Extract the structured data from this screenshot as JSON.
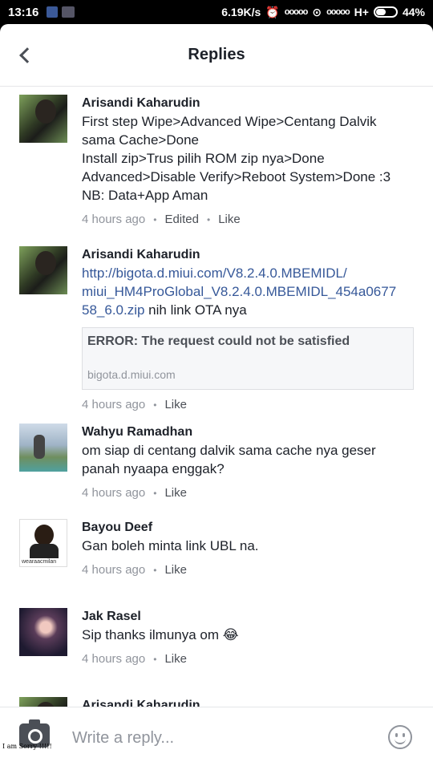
{
  "status_bar": {
    "time": "13:16",
    "speed": "6.19K/s",
    "signal_a": "ooooo",
    "signal_b": "ooooo",
    "network": "H+",
    "battery": "44%"
  },
  "header": {
    "title": "Replies",
    "back_icon": "chevron-left-icon"
  },
  "comments": [
    {
      "author": "Arisandi Kaharudin",
      "lines": [
        "First step Wipe>Advanced Wipe>Centang Dalvik",
        "sama Cache>Done",
        "Install zip>Trus pilih ROM zip nya>Done",
        "Advanced>Disable Verify>Reboot System>Done :3",
        "NB: Data+App Aman"
      ],
      "time": "4 hours ago",
      "edited": "Edited",
      "like": "Like"
    },
    {
      "author": "Arisandi Kaharudin",
      "link_lines": [
        "http://bigota.d.miui.com/V8.2.4.0.MBEMIDL/",
        "miui_HM4ProGlobal_V8.2.4.0.MBEMIDL_454a0677",
        "58_6.0.zip"
      ],
      "suffix": " nih link OTA nya",
      "preview": {
        "title": "ERROR: The request could not be satisfied",
        "domain": "bigota.d.miui.com"
      },
      "time": "4 hours ago",
      "like": "Like"
    },
    {
      "author": "Wahyu Ramadhan",
      "lines": [
        "om siap di centang dalvik sama cache nya geser",
        "panah nyaapa enggak?"
      ],
      "time": "4 hours ago",
      "like": "Like"
    },
    {
      "author": "Bayou Deef",
      "avatar_tag": "wearaacmilan",
      "lines": [
        "Gan boleh minta link UBL na."
      ],
      "time": "4 hours ago",
      "like": "Like"
    },
    {
      "author": "Jak Rasel",
      "lines": [
        "Sip thanks ilmunya om 😂"
      ],
      "time": "4 hours ago",
      "like": "Like"
    },
    {
      "author": "Arisandi Kaharudin"
    }
  ],
  "footer": {
    "placeholder": "Write a reply...",
    "watermark": "I am Sorry !!!!!",
    "camera_icon": "camera-icon",
    "emoji_icon": "smiley-icon"
  }
}
